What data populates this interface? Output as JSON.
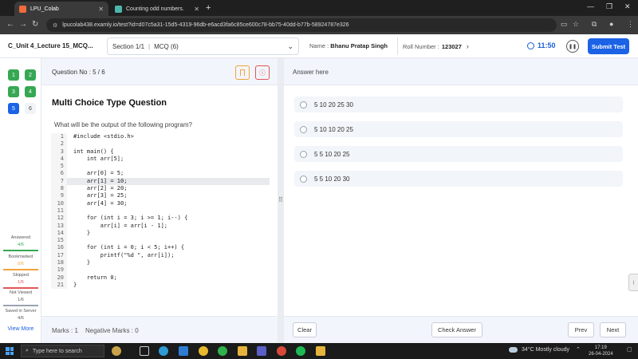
{
  "browser": {
    "tabs": [
      {
        "title": "LPU_Colab"
      },
      {
        "title": "Counting odd numbers."
      }
    ],
    "url": "lpucolab438.examly.io/test?id=d07c5a31-15d5-4319-96db-e6acd3fa6c85ce600c78-bb75-40dd-b77b-58924787e326"
  },
  "header": {
    "course": "C_Unit 4_Lecture 15_MCQ...",
    "section_label": "Section 1/1",
    "section_value": "MCQ (6)",
    "name_label": "Name :",
    "name_value": "Bhanu Pratap Singh",
    "roll_label": "Roll Number :",
    "roll_value": "123027",
    "timer": "11:50",
    "submit_label": "Submit Test"
  },
  "palette": {
    "numbers": [
      {
        "n": "1",
        "status": "answered"
      },
      {
        "n": "2",
        "status": "answered"
      },
      {
        "n": "3",
        "status": "answered"
      },
      {
        "n": "4",
        "status": "answered"
      },
      {
        "n": "5",
        "status": "current"
      },
      {
        "n": "6",
        "status": "not-viewed"
      }
    ],
    "legend": [
      {
        "label": "Answered",
        "count": "4/6",
        "color": "#36a853"
      },
      {
        "label": "Bookmarked",
        "count": "0/6",
        "color": "#f2a33c"
      },
      {
        "label": "Skipped",
        "count": "1/6",
        "color": "#e05656"
      },
      {
        "label": "Not Viewed",
        "count": "1/6",
        "color": "#9aa3b0"
      },
      {
        "label": "Saved in Server",
        "count": "4/6",
        "color": ""
      }
    ],
    "view_more": "View More"
  },
  "question": {
    "number_label": "Question No : 5 / 6",
    "type": "Multi Choice Type Question",
    "text": "What will be the output of the following program?",
    "code": [
      "#include <stdio.h>",
      "",
      "int main() {",
      "    int arr[5];",
      "",
      "    arr[0] = 5;",
      "    arr[1] = 10;",
      "    arr[2] = 20;",
      "    arr[3] = 25;",
      "    arr[4] = 30;",
      "",
      "    for (int i = 3; i >= 1; i--) {",
      "        arr[i] = arr[i - 1];",
      "    }",
      "",
      "    for (int i = 0; i < 5; i++) {",
      "        printf(\"%d \", arr[i]);",
      "    }",
      "",
      "    return 0;",
      "}"
    ],
    "highlight_line": 7,
    "marks": "Marks : 1",
    "negative_marks": "Negative Marks : 0"
  },
  "answer": {
    "title": "Answer here",
    "options": [
      "5 10 20 25 30",
      "5 10 10 20 25",
      "5 5 10 20 25",
      "5 5 10 20 30"
    ],
    "clear_label": "Clear",
    "check_label": "Check Answer",
    "prev_label": "Prev",
    "next_label": "Next"
  },
  "taskbar": {
    "search_placeholder": "Type here to search",
    "weather_temp": "34°C",
    "weather_desc": "Mostly cloudy",
    "time": "17:19",
    "date": "26-04-2024"
  },
  "colors": {
    "primary": "#1b62e6",
    "answered": "#36a853",
    "bookmark": "#f2a33c",
    "report": "#e05656"
  }
}
